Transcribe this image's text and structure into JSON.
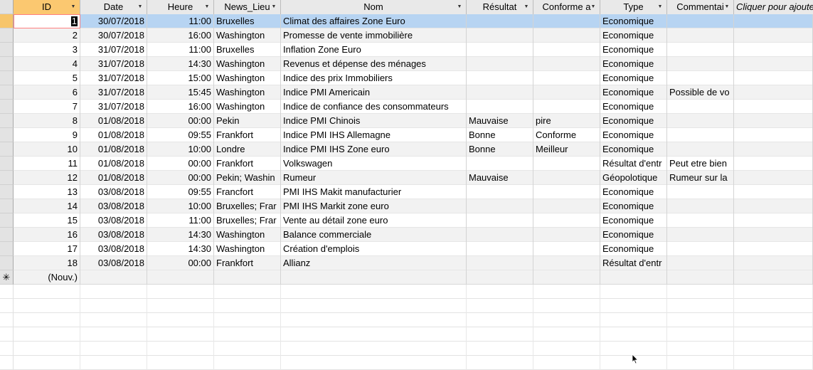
{
  "columns": [
    {
      "key": "id",
      "label": "ID",
      "has_dropdown": true
    },
    {
      "key": "date",
      "label": "Date",
      "has_dropdown": true
    },
    {
      "key": "heure",
      "label": "Heure",
      "has_dropdown": true
    },
    {
      "key": "lieu",
      "label": "News_Lieu",
      "has_dropdown": true
    },
    {
      "key": "nom",
      "label": "Nom",
      "has_dropdown": true
    },
    {
      "key": "resultat",
      "label": "Résultat",
      "has_dropdown": true
    },
    {
      "key": "conforme",
      "label": "Conforme a",
      "has_dropdown": true
    },
    {
      "key": "type",
      "label": "Type",
      "has_dropdown": true
    },
    {
      "key": "commentaire",
      "label": "Commentai",
      "has_dropdown": true
    },
    {
      "key": "add",
      "label": "Cliquer pour ajouter",
      "has_dropdown": false
    }
  ],
  "rows": [
    {
      "id": "1",
      "date": "30/07/2018",
      "heure": "11:00",
      "lieu": "Bruxelles",
      "nom": "Climat des affaires Zone Euro",
      "resultat": "",
      "conforme": "",
      "type": "Economique",
      "commentaire": ""
    },
    {
      "id": "2",
      "date": "30/07/2018",
      "heure": "16:00",
      "lieu": "Washington",
      "nom": "Promesse de vente immobilière",
      "resultat": "",
      "conforme": "",
      "type": "Economique",
      "commentaire": ""
    },
    {
      "id": "3",
      "date": "31/07/2018",
      "heure": "11:00",
      "lieu": "Bruxelles",
      "nom": "Inflation Zone Euro",
      "resultat": "",
      "conforme": "",
      "type": "Economique",
      "commentaire": ""
    },
    {
      "id": "4",
      "date": "31/07/2018",
      "heure": "14:30",
      "lieu": "Washington",
      "nom": "Revenus et dépense des ménages",
      "resultat": "",
      "conforme": "",
      "type": "Economique",
      "commentaire": ""
    },
    {
      "id": "5",
      "date": "31/07/2018",
      "heure": "15:00",
      "lieu": "Washington",
      "nom": "Indice des prix Immobiliers",
      "resultat": "",
      "conforme": "",
      "type": "Economique",
      "commentaire": ""
    },
    {
      "id": "6",
      "date": "31/07/2018",
      "heure": "15:45",
      "lieu": "Washington",
      "nom": "Indice PMI Americain",
      "resultat": "",
      "conforme": "",
      "type": "Economique",
      "commentaire": "Possible de vo"
    },
    {
      "id": "7",
      "date": "31/07/2018",
      "heure": "16:00",
      "lieu": "Washington",
      "nom": "Indice de confiance des consommateurs",
      "resultat": "",
      "conforme": "",
      "type": "Economique",
      "commentaire": ""
    },
    {
      "id": "8",
      "date": "01/08/2018",
      "heure": "00:00",
      "lieu": "Pekin",
      "nom": "Indice PMI Chinois",
      "resultat": "Mauvaise",
      "conforme": "pire",
      "type": "Economique",
      "commentaire": ""
    },
    {
      "id": "9",
      "date": "01/08/2018",
      "heure": "09:55",
      "lieu": "Frankfort",
      "nom": "Indice PMI IHS Allemagne",
      "resultat": "Bonne",
      "conforme": "Conforme",
      "type": "Economique",
      "commentaire": ""
    },
    {
      "id": "10",
      "date": "01/08/2018",
      "heure": "10:00",
      "lieu": "Londre",
      "nom": "Indice PMI IHS Zone euro",
      "resultat": "Bonne",
      "conforme": "Meilleur",
      "type": "Economique",
      "commentaire": ""
    },
    {
      "id": "11",
      "date": "01/08/2018",
      "heure": "00:00",
      "lieu": "Frankfort",
      "nom": "Volkswagen",
      "resultat": "",
      "conforme": "",
      "type": "Résultat d'entr",
      "commentaire": "Peut etre bien"
    },
    {
      "id": "12",
      "date": "01/08/2018",
      "heure": "00:00",
      "lieu": "Pekin; Washin",
      "nom": "Rumeur",
      "resultat": "Mauvaise",
      "conforme": "",
      "type": "Géopolotique",
      "commentaire": "Rumeur sur la"
    },
    {
      "id": "13",
      "date": "03/08/2018",
      "heure": "09:55",
      "lieu": "Francfort",
      "nom": "PMI IHS Makit manufacturier",
      "resultat": "",
      "conforme": "",
      "type": "Economique",
      "commentaire": ""
    },
    {
      "id": "14",
      "date": "03/08/2018",
      "heure": "10:00",
      "lieu": "Bruxelles; Frar",
      "nom": "PMI IHS Markit zone euro",
      "resultat": "",
      "conforme": "",
      "type": "Economique",
      "commentaire": ""
    },
    {
      "id": "15",
      "date": "03/08/2018",
      "heure": "11:00",
      "lieu": "Bruxelles; Frar",
      "nom": "Vente au détail zone euro",
      "resultat": "",
      "conforme": "",
      "type": "Economique",
      "commentaire": ""
    },
    {
      "id": "16",
      "date": "03/08/2018",
      "heure": "14:30",
      "lieu": "Washington",
      "nom": "Balance commerciale",
      "resultat": "",
      "conforme": "",
      "type": "Economique",
      "commentaire": ""
    },
    {
      "id": "17",
      "date": "03/08/2018",
      "heure": "14:30",
      "lieu": "Washington",
      "nom": "Création d'emplois",
      "resultat": "",
      "conforme": "",
      "type": "Economique",
      "commentaire": ""
    },
    {
      "id": "18",
      "date": "03/08/2018",
      "heure": "00:00",
      "lieu": "Frankfort",
      "nom": "Allianz",
      "resultat": "",
      "conforme": "",
      "type": "Résultat d'entr",
      "commentaire": ""
    }
  ],
  "new_record": {
    "marker": "✳",
    "label": "(Nouv.)"
  },
  "selected_row_index": 0,
  "colors": {
    "id_header": "#fbc870",
    "selected_row": "#b7d4f2",
    "alt_row": "#f2f2f2"
  }
}
